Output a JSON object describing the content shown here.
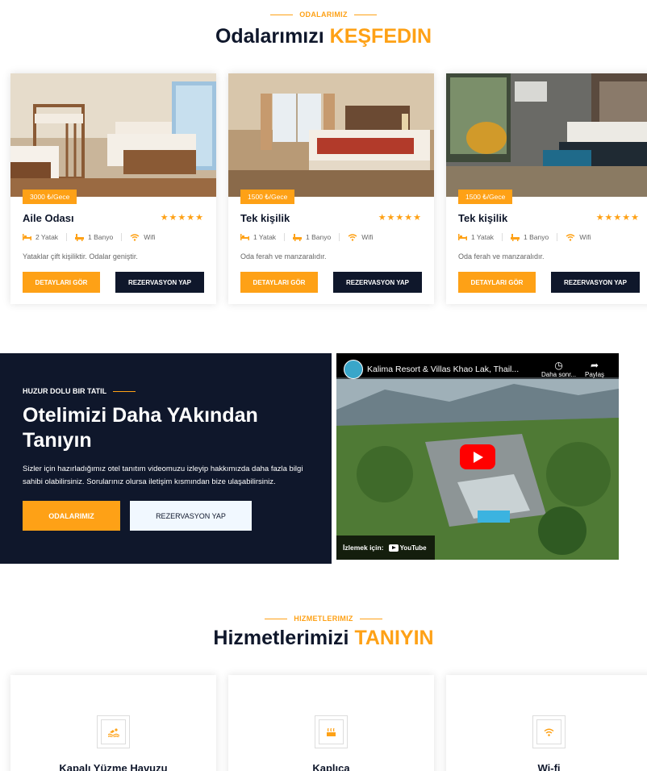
{
  "rooms_section": {
    "subtitle": "ODALARIMIZ",
    "title_main": "Odalarımızı ",
    "title_accent": "KEŞFEDIN"
  },
  "rooms": [
    {
      "price": "3000 ₺/Gece",
      "name": "Aile Odası",
      "stars": "★★★★★",
      "rating": 5,
      "beds": "2 Yatak",
      "baths": "1 Banyo",
      "wifi": "Wifi",
      "description": "Yataklar çift kişiliktir. Odalar geniştir.",
      "details_label": "DETAYLARI GÖR",
      "reserve_label": "REZERVASYON YAP"
    },
    {
      "price": "1500 ₺/Gece",
      "name": "Tek kişilik",
      "stars": "★★★★★",
      "rating": 5,
      "beds": "1 Yatak",
      "baths": "1 Banyo",
      "wifi": "Wifi",
      "description": "Oda ferah ve manzaralıdır.",
      "details_label": "DETAYLARI GÖR",
      "reserve_label": "REZERVASYON YAP"
    },
    {
      "price": "1500 ₺/Gece",
      "name": "Tek kişilik",
      "stars": "★★★★★",
      "rating": 5,
      "beds": "1 Yatak",
      "baths": "1 Banyo",
      "wifi": "Wifi",
      "description": "Oda ferah ve manzaralıdır.",
      "details_label": "DETAYLARI GÖR",
      "reserve_label": "REZERVASYON YAP"
    }
  ],
  "video_section": {
    "subtitle": "HUZUR DOLU BIR TATIL",
    "title": "Otelimizi Daha YAkından Tanıyın",
    "text": "Sizler için hazırladığımız otel tanıtım videomuzu izleyip hakkımızda daha fazla bilgi sahibi olabilirsiniz. Sorularınız olursa iletişim kısmından bize ulaşabilirsiniz.",
    "rooms_button": "ODALARIMIZ",
    "reserve_button": "REZERVASYON YAP"
  },
  "video_player": {
    "title": "Kalima Resort & Villas Khao Lak, Thail...",
    "watch_later": "Daha sonr...",
    "share": "Paylaş",
    "watch_on": "İzlemek için:",
    "platform": "YouTube"
  },
  "services_section": {
    "subtitle": "HIZMETLERIMIZ",
    "title_main": "Hizmetlerimizi ",
    "title_accent": "TANIYIN"
  },
  "services": [
    {
      "name": "Kapalı Yüzme Havuzu",
      "icon": "swimmer-icon"
    },
    {
      "name": "Kaplıca",
      "icon": "spa-icon"
    },
    {
      "name": "Wi-fi",
      "icon": "wifi-icon"
    }
  ],
  "colors": {
    "accent": "#fea116",
    "dark": "#0f172b",
    "light_button": "#f1f8ff",
    "youtube_red": "#ff0000"
  }
}
